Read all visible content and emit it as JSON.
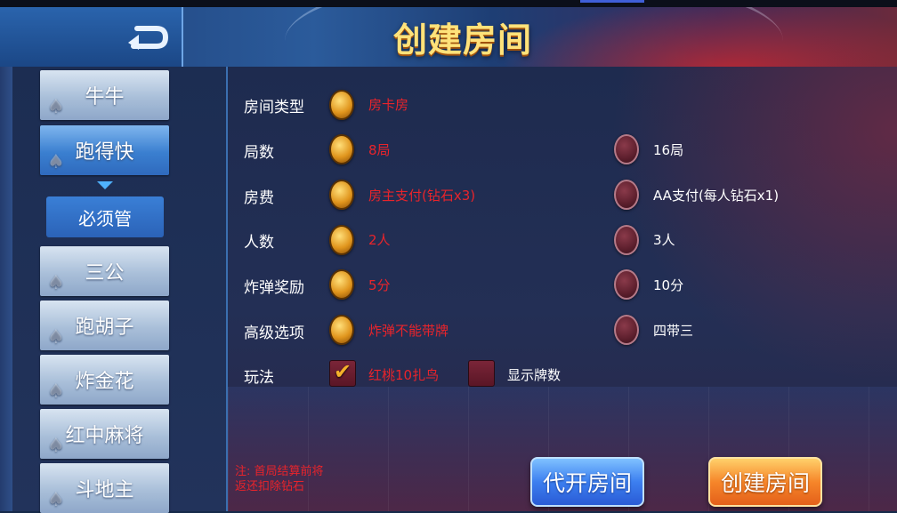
{
  "header": {
    "title": "创建房间"
  },
  "sidebar": {
    "games": [
      "牛牛",
      "跑得快",
      "三公",
      "跑胡子",
      "炸金花",
      "红中麻将",
      "斗地主"
    ],
    "sub_item": "必须管"
  },
  "options": {
    "room_type": {
      "label": "房间类型",
      "choice1": "房卡房"
    },
    "rounds": {
      "label": "局数",
      "choice1": "8局",
      "choice2": "16局"
    },
    "fee": {
      "label": "房费",
      "choice1": "房主支付(钻石x3)",
      "choice2": "AA支付(每人钻石x1)"
    },
    "players": {
      "label": "人数",
      "choice1": "2人",
      "choice2": "3人"
    },
    "bomb_bonus": {
      "label": "炸弹奖励",
      "choice1": "5分",
      "choice2": "10分"
    },
    "advanced": {
      "label": "高级选项",
      "choice1": "炸弹不能带牌",
      "choice2": "四带三"
    },
    "play": {
      "label": "玩法",
      "check1": "红桃10扎鸟",
      "check2": "显示牌数"
    }
  },
  "note": {
    "line1": "注: 首局结算前将",
    "line2": "返还扣除钻石"
  },
  "buttons": {
    "proxy_open": "代开房间",
    "create": "创建房间"
  },
  "colors": {
    "selected_text": "#e8242b",
    "unselected_text": "#ffffff"
  }
}
